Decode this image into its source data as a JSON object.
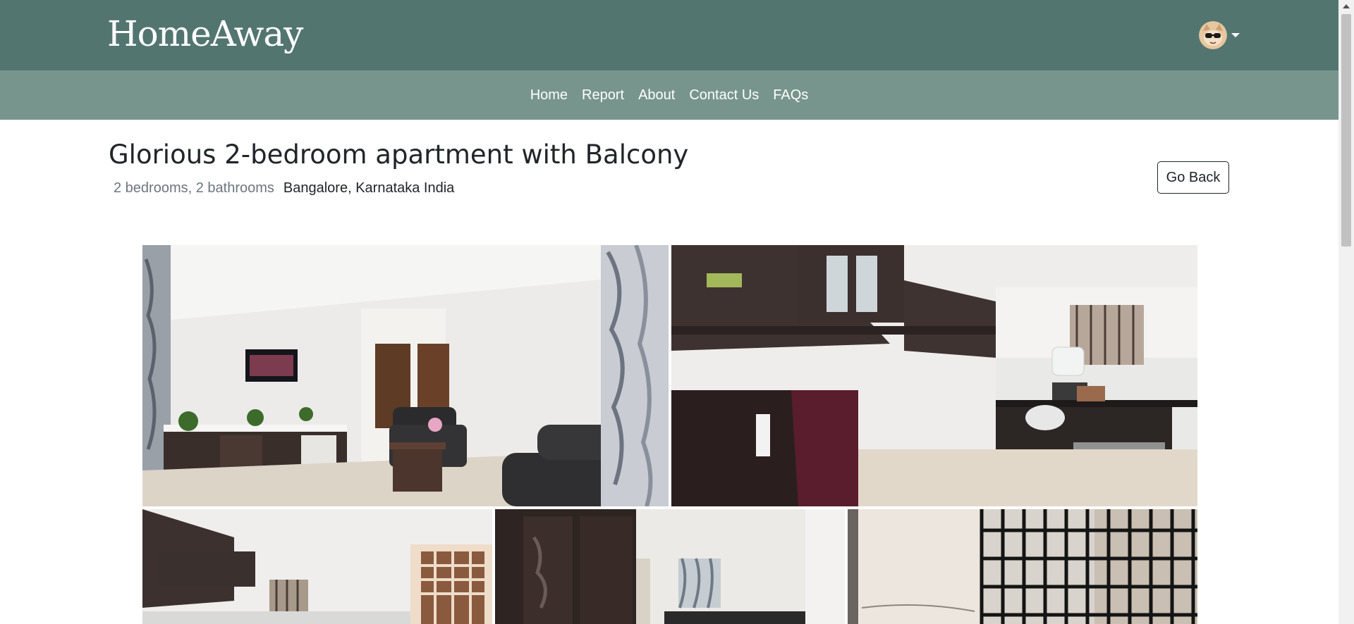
{
  "brand": {
    "name": "HomeAway"
  },
  "nav": {
    "items": [
      {
        "label": "Home"
      },
      {
        "label": "Report"
      },
      {
        "label": "About"
      },
      {
        "label": "Contact Us"
      },
      {
        "label": "FAQs"
      }
    ]
  },
  "listing": {
    "title": "Glorious 2-bedroom apartment with Balcony",
    "rooms": "2 bedrooms, 2 bathrooms",
    "location": "Bangalore, Karnataka India",
    "back_label": "Go Back",
    "photos": [
      {
        "name": "photo-living-room"
      },
      {
        "name": "photo-kitchen"
      },
      {
        "name": "photo-kitchen-window"
      },
      {
        "name": "photo-bedroom-wardrobe"
      },
      {
        "name": "photo-balcony"
      }
    ]
  },
  "colors": {
    "header": "#537570",
    "nav": "#77958c",
    "text": "#212529",
    "muted": "#6c757d"
  },
  "icons": {
    "user": "user-avatar",
    "dropdown": "caret-down-icon"
  }
}
